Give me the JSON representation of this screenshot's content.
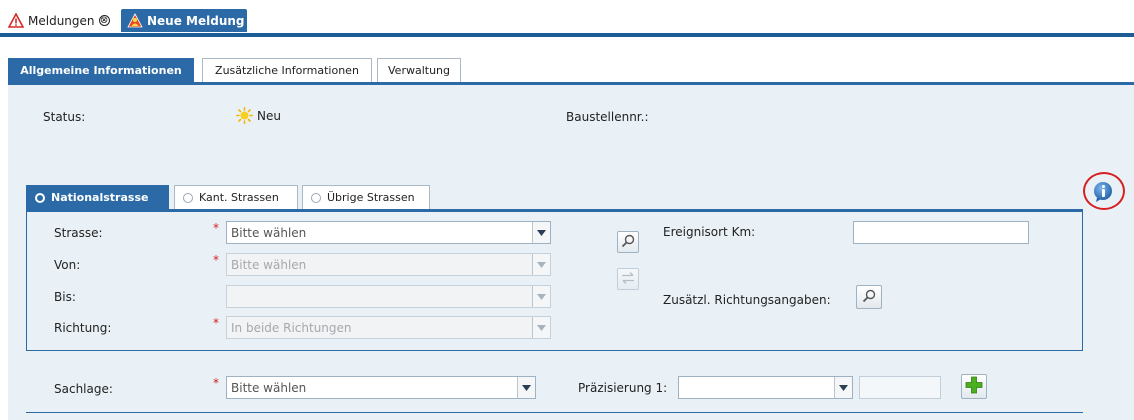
{
  "doc_tabs": [
    {
      "label": "Meldungen",
      "icon": "warning-icon",
      "close": "⊗"
    },
    {
      "label": "Neue Meldung",
      "icon": "warning-user-icon",
      "close": "⊠"
    }
  ],
  "sub_tabs": [
    "Allgemeine Informationen",
    "Zusätzliche Informationen",
    "Verwaltung"
  ],
  "status": {
    "label": "Status:",
    "value": "Neu",
    "icon": "sun-icon"
  },
  "baustelle": {
    "label": "Baustellennr.:"
  },
  "road_tabs": [
    "Nationalstrasse",
    "Kant. Strassen",
    "Übrige Strassen"
  ],
  "form": {
    "strasse": {
      "label": "Strasse:",
      "value": "Bitte wählen",
      "required": "*"
    },
    "von": {
      "label": "Von:",
      "value": "Bitte wählen",
      "required": "*"
    },
    "bis": {
      "label": "Bis:",
      "value": ""
    },
    "richtung": {
      "label": "Richtung:",
      "value": "In beide Richtungen",
      "required": "*"
    },
    "ereignisort": {
      "label": "Ereignisort Km:",
      "value": ""
    },
    "zusatz": {
      "label": "Zusätzl. Richtungsangaben:"
    }
  },
  "sachlage": {
    "label": "Sachlage:",
    "value": "Bitte wählen",
    "required": "*"
  },
  "praezisierung": {
    "label": "Präzisierung 1:",
    "value": "",
    "extra": ""
  },
  "colors": {
    "accent": "#2b6aa6",
    "panel": "#eaf1f6",
    "required": "#d02020",
    "info_circle": "#d42020"
  }
}
